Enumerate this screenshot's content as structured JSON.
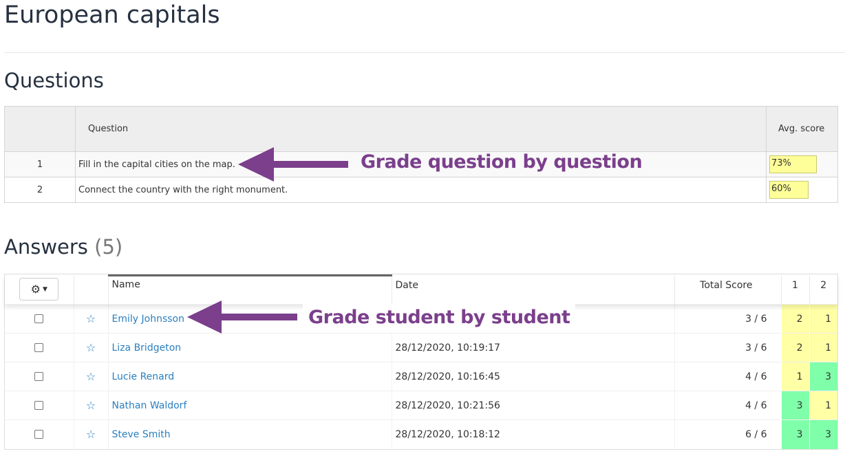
{
  "page": {
    "title": "European capitals"
  },
  "questions": {
    "title": "Questions",
    "columns": {
      "number": "",
      "question": "Question",
      "avg_score": "Avg. score"
    },
    "rows": [
      {
        "number": "1",
        "text": "Fill in the capital cities on the map.",
        "avg_score": "73%",
        "avg_score_value": 73
      },
      {
        "number": "2",
        "text": "Connect the country with the right monument.",
        "avg_score": "60%",
        "avg_score_value": 60
      }
    ],
    "score_bar_color": "#ffff99"
  },
  "answers": {
    "title": "Answers",
    "count": "(5)",
    "toolbar": {
      "settings_icon": "gear-icon",
      "settings_caret": "caret-down-icon"
    },
    "columns": {
      "name": "Name",
      "date": "Date",
      "total": "Total Score",
      "q1": "1",
      "q2": "2"
    },
    "sorted_column": "name",
    "rows": [
      {
        "name": "Emily Johnsson",
        "date": "",
        "total": "3 / 6",
        "q1": "2",
        "q2": "1",
        "q1_color": "yellow",
        "q2_color": "yellow",
        "checked": false
      },
      {
        "name": "Liza Bridgeton",
        "date": "28/12/2020, 10:19:17",
        "total": "3 / 6",
        "q1": "2",
        "q2": "1",
        "q1_color": "yellow",
        "q2_color": "yellow",
        "checked": false
      },
      {
        "name": "Lucie Renard",
        "date": "28/12/2020, 10:16:45",
        "total": "4 / 6",
        "q1": "1",
        "q2": "3",
        "q1_color": "yellow",
        "q2_color": "green",
        "checked": false
      },
      {
        "name": "Nathan Waldorf",
        "date": "28/12/2020, 10:21:56",
        "total": "4 / 6",
        "q1": "3",
        "q2": "1",
        "q1_color": "green",
        "q2_color": "yellow",
        "checked": false
      },
      {
        "name": "Steve Smith",
        "date": "28/12/2020, 10:18:12",
        "total": "6 / 6",
        "q1": "3",
        "q2": "3",
        "q1_color": "green",
        "q2_color": "green",
        "checked": false
      }
    ],
    "colors": {
      "yellow": "#ffffa6",
      "green": "#80ffaa",
      "link": "#2a7fbf"
    }
  },
  "annotations": {
    "question": "Grade question by question",
    "student": "Grade student by student",
    "color": "#7b3f8c"
  }
}
